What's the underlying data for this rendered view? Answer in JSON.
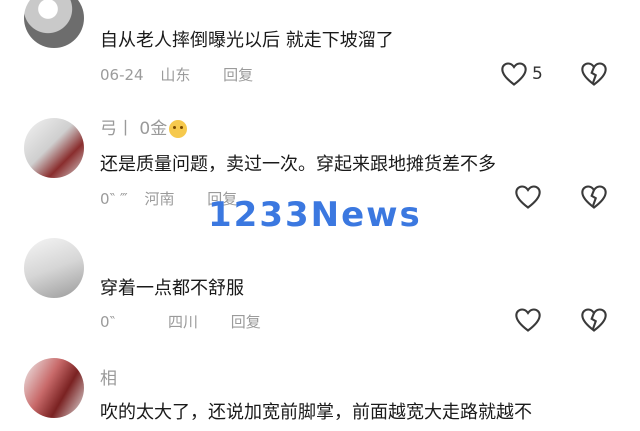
{
  "comments": [
    {
      "username": "",
      "text": "自从老人摔倒曝光以后 就走下坡溜了",
      "date": "06-24",
      "location": "山东",
      "reply_label": "回复",
      "like_count": "5"
    },
    {
      "username": "弓丨 0金",
      "text": "还是质量问题，卖过一次。穿起来跟地摊货差不多",
      "date": "0‶ ‴",
      "location": "河南",
      "reply_label": "回复",
      "like_count": ""
    },
    {
      "username": "",
      "text": "穿着一点都不舒服",
      "date": "0‶",
      "location": "四川",
      "reply_label": "回复",
      "like_count": ""
    },
    {
      "username": "相",
      "text": "吹的太大了，还说加宽前脚掌，前面越宽大走路就越不",
      "date": "",
      "location": "",
      "reply_label": "",
      "like_count": ""
    }
  ],
  "watermark": "1233News",
  "colors": {
    "text": "#1a1a1a",
    "meta": "#9b9b9b",
    "watermark": "#3b78e0"
  }
}
